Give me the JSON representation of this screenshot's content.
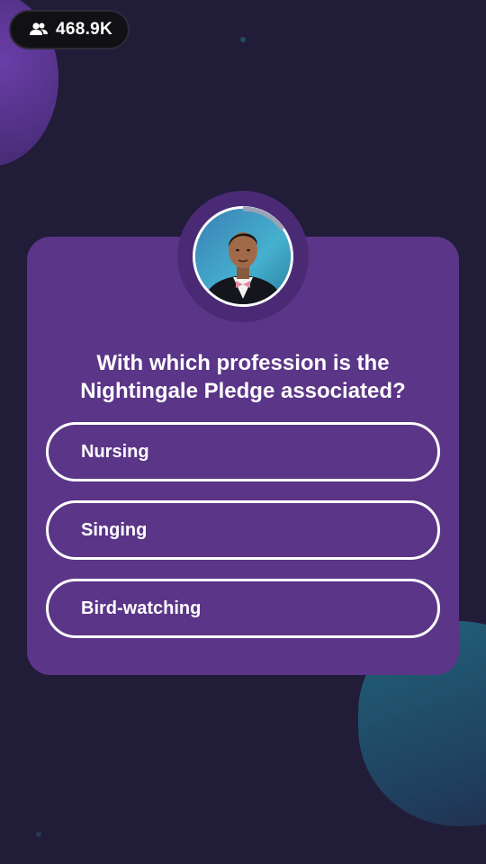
{
  "viewers": {
    "icon": "people-icon",
    "count": "468.9K"
  },
  "host": {
    "avatar_icon": "host-avatar"
  },
  "question": {
    "text": "With which profession is the Nightingale Pledge associated?"
  },
  "options": [
    {
      "label": "Nursing"
    },
    {
      "label": "Singing"
    },
    {
      "label": "Bird-watching"
    }
  ],
  "colors": {
    "background": "#211c38",
    "card": "#5b3587",
    "option_border": "#ffffff"
  }
}
